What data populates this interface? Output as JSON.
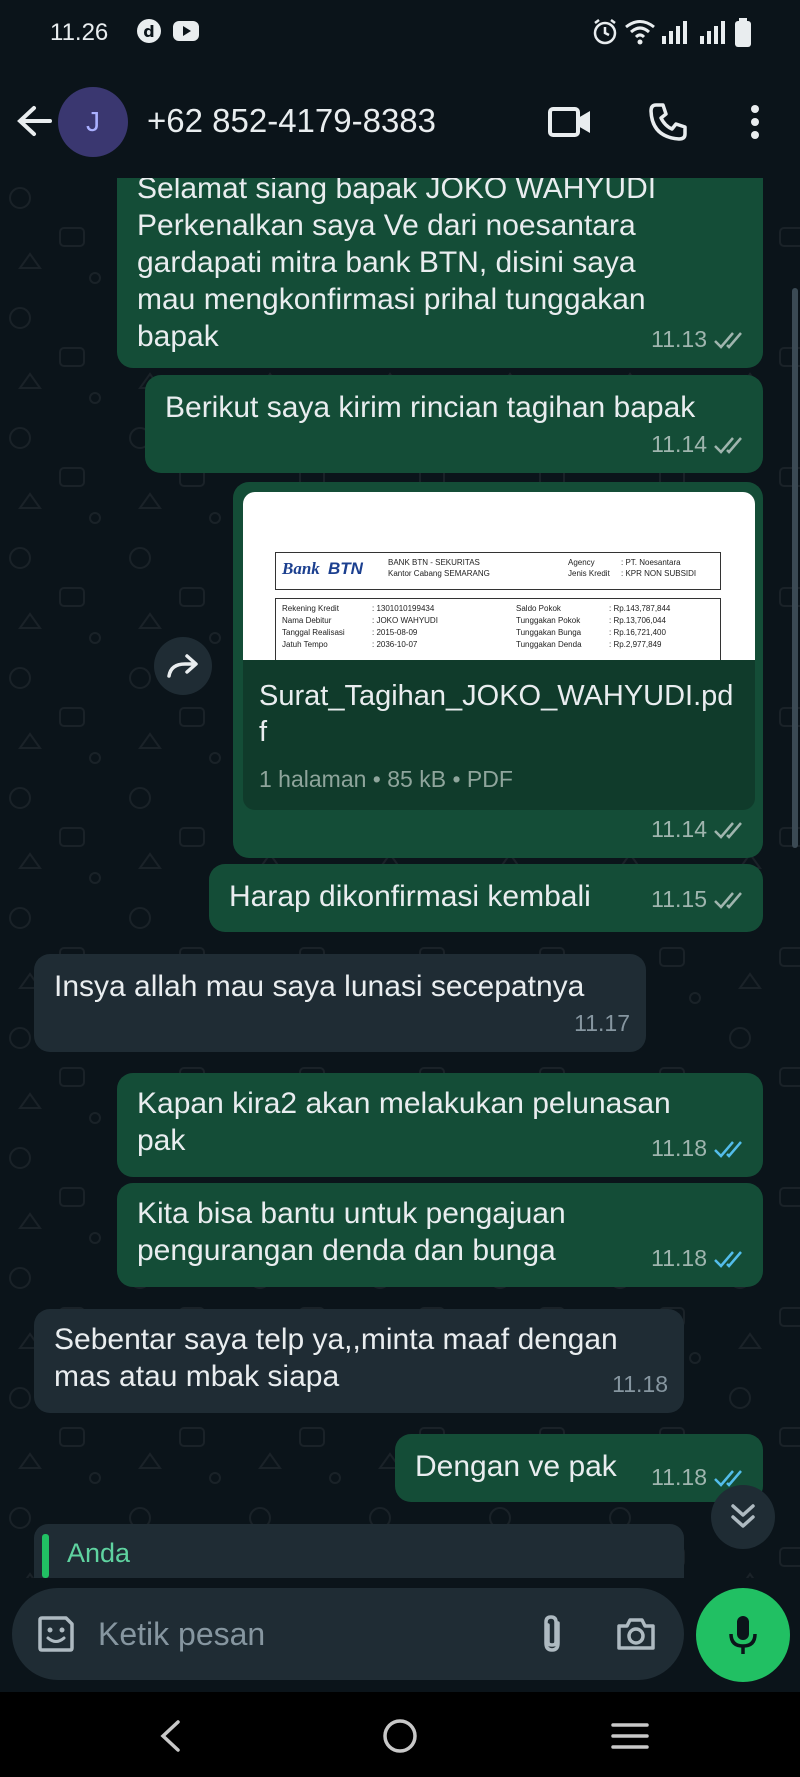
{
  "status_bar": {
    "time": "11.26"
  },
  "header": {
    "avatar_initial": "J",
    "contact_name": "+62 852-4179-8383"
  },
  "messages": [
    {
      "id": "m1",
      "direction": "out",
      "text": "Selamat siang bapak JOKO WAHYUDI\nPerkenalkan saya Ve dari noesantara\ngardapati mitra bank BTN, disini saya\nmau mengkonfirmasi prihal tunggakan\nbapak",
      "time": "11.13",
      "status": "read"
    },
    {
      "id": "m2",
      "direction": "out",
      "text": "Berikut saya kirim rincian tagihan bapak",
      "time": "11.14",
      "status": "read"
    },
    {
      "id": "m3",
      "direction": "out",
      "type": "document",
      "time": "11.14",
      "status": "read",
      "document": {
        "file_name": "Surat_Tagihan_JOKO_WAHYUDI.pdf",
        "details": "1 halaman • 85 kB • PDF",
        "preview": {
          "brand": "Bank",
          "brand_strong": "BTN",
          "bank_line1": "BANK BTN - SEKURITAS",
          "bank_line2": "Kantor Cabang SEMARANG",
          "agency_label": "Agency",
          "agency_value": ": PT. Noesantara",
          "credit_type_label": "Jenis Kredit",
          "credit_type_value": ": KPR NON SUBSIDI",
          "rows": [
            {
              "label": "Rekening Kredit",
              "value": ": 1301010199434",
              "label2": "Saldo Pokok",
              "value2": ": Rp.143,787,844"
            },
            {
              "label": "Nama Debitur",
              "value": ": JOKO WAHYUDI",
              "label2": "Tunggakan Pokok",
              "value2": ": Rp.13,706,044"
            },
            {
              "label": "Tanggal Realisasi",
              "value": ": 2015-08-09",
              "label2": "Tunggakan Bunga",
              "value2": ": Rp.16,721,400"
            },
            {
              "label": "Jatuh Tempo",
              "value": ": 2036-10-07",
              "label2": "Tunggakan Denda",
              "value2": ": Rp.2,977,849"
            }
          ]
        }
      }
    },
    {
      "id": "m4",
      "direction": "out",
      "text": "Harap dikonfirmasi kembali",
      "time": "11.15",
      "status": "read"
    },
    {
      "id": "m5",
      "direction": "in",
      "text": "Insya allah mau saya lunasi secepatnya",
      "time": "11.17"
    },
    {
      "id": "m6",
      "direction": "out",
      "text": "Kapan kira2 akan melakukan pelunasan\npak",
      "time": "11.18",
      "status": "read-blue"
    },
    {
      "id": "m7",
      "direction": "out",
      "text": "Kita bisa bantu untuk pengajuan\npengurangan denda dan bunga",
      "time": "11.18",
      "status": "read-blue"
    },
    {
      "id": "m8",
      "direction": "in",
      "text": "Sebentar saya telp ya,,minta maaf dengan\nmas atau mbak siapa",
      "time": "11.18"
    },
    {
      "id": "m9",
      "direction": "out",
      "text": "Dengan ve pak",
      "time": "11.18",
      "status": "read-blue"
    }
  ],
  "reply_preview": {
    "author": "Anda"
  },
  "input": {
    "placeholder": "Ketik pesan",
    "value": ""
  },
  "colors": {
    "background": "#0b141a",
    "outgoing_bubble": "#144d37",
    "incoming_bubble": "#1f2c34",
    "accent_green": "#21c063",
    "read_tick_blue": "#53bdeb",
    "delivered_tick_grey": "#9fb5ae"
  },
  "icons": {
    "back": "arrow-left-icon",
    "video": "video-camera-icon",
    "call": "phone-icon",
    "menu": "more-vertical-icon",
    "forward": "forward-icon",
    "scroll_down": "double-chevron-down-icon",
    "sticker": "sticker-icon",
    "attach": "paperclip-icon",
    "camera": "camera-icon",
    "mic": "microphone-icon"
  }
}
